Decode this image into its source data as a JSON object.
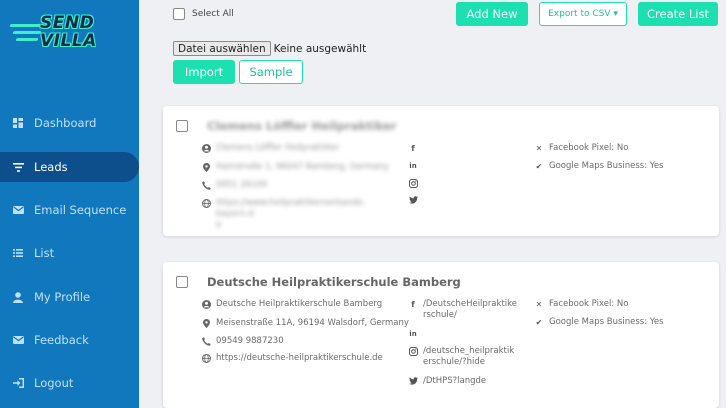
{
  "brand": {
    "logo_line1": "SEND",
    "logo_line2": "VILLA"
  },
  "sidebar": {
    "items": [
      {
        "label": "Dashboard",
        "icon": "dashboard-icon",
        "active": false
      },
      {
        "label": "Leads",
        "icon": "filter-icon",
        "active": true
      },
      {
        "label": "Email Sequence",
        "icon": "envelope-icon",
        "active": false
      },
      {
        "label": "List",
        "icon": "list-icon",
        "active": false
      },
      {
        "label": "My Profile",
        "icon": "user-icon",
        "active": false
      },
      {
        "label": "Feedback",
        "icon": "envelope-icon",
        "active": false
      },
      {
        "label": "Logout",
        "icon": "logout-icon",
        "active": false
      }
    ]
  },
  "toolbar": {
    "select_all_label": "Select All",
    "add_new_label": "Add New",
    "export_label": "Export to CSV ▾",
    "create_list_label": "Create List",
    "file_button_label": "Datei auswählen",
    "file_status": "Keine ausgewählt",
    "import_label": "Import",
    "sample_label": "Sample"
  },
  "leads": [
    {
      "title": "Clemens Löffler Heilpraktiker",
      "name": "Clemens Löffler Heilpraktiker",
      "address": "Hainstraße 1, 96047 Bamberg, Germany",
      "phone": "0951 26100",
      "website": "https://www.heilpraktikerverbands-bayern.d",
      "website_cont": "e",
      "facebook": "",
      "linkedin": "",
      "instagram": "",
      "twitter": "",
      "facebook_pixel": "Facebook Pixel: No",
      "google_maps": "Google Maps Business: Yes",
      "blurred": true
    },
    {
      "title": "Deutsche Heilpraktikerschule Bamberg",
      "name": "Deutsche Heilpraktikerschule Bamberg",
      "address": "Meisenstraße 11A, 96194 Walsdorf, Germany",
      "phone": "09549 9887230",
      "website": "https://deutsche-heilpraktikerschule.de",
      "facebook": "/DeutscheHeilpraktike",
      "facebook_cont": "rschule/",
      "linkedin": "",
      "instagram": "/deutsche_heilpraktik",
      "instagram_cont": "erschule/?hide",
      "twitter": "/DtHPS?langde",
      "facebook_pixel": "Facebook Pixel: No",
      "google_maps": "Google Maps Business: Yes",
      "blurred": false
    }
  ],
  "colors": {
    "sidebar": "#1278be",
    "active_nav": "#0d4f8c",
    "accent": "#1de0b0"
  }
}
